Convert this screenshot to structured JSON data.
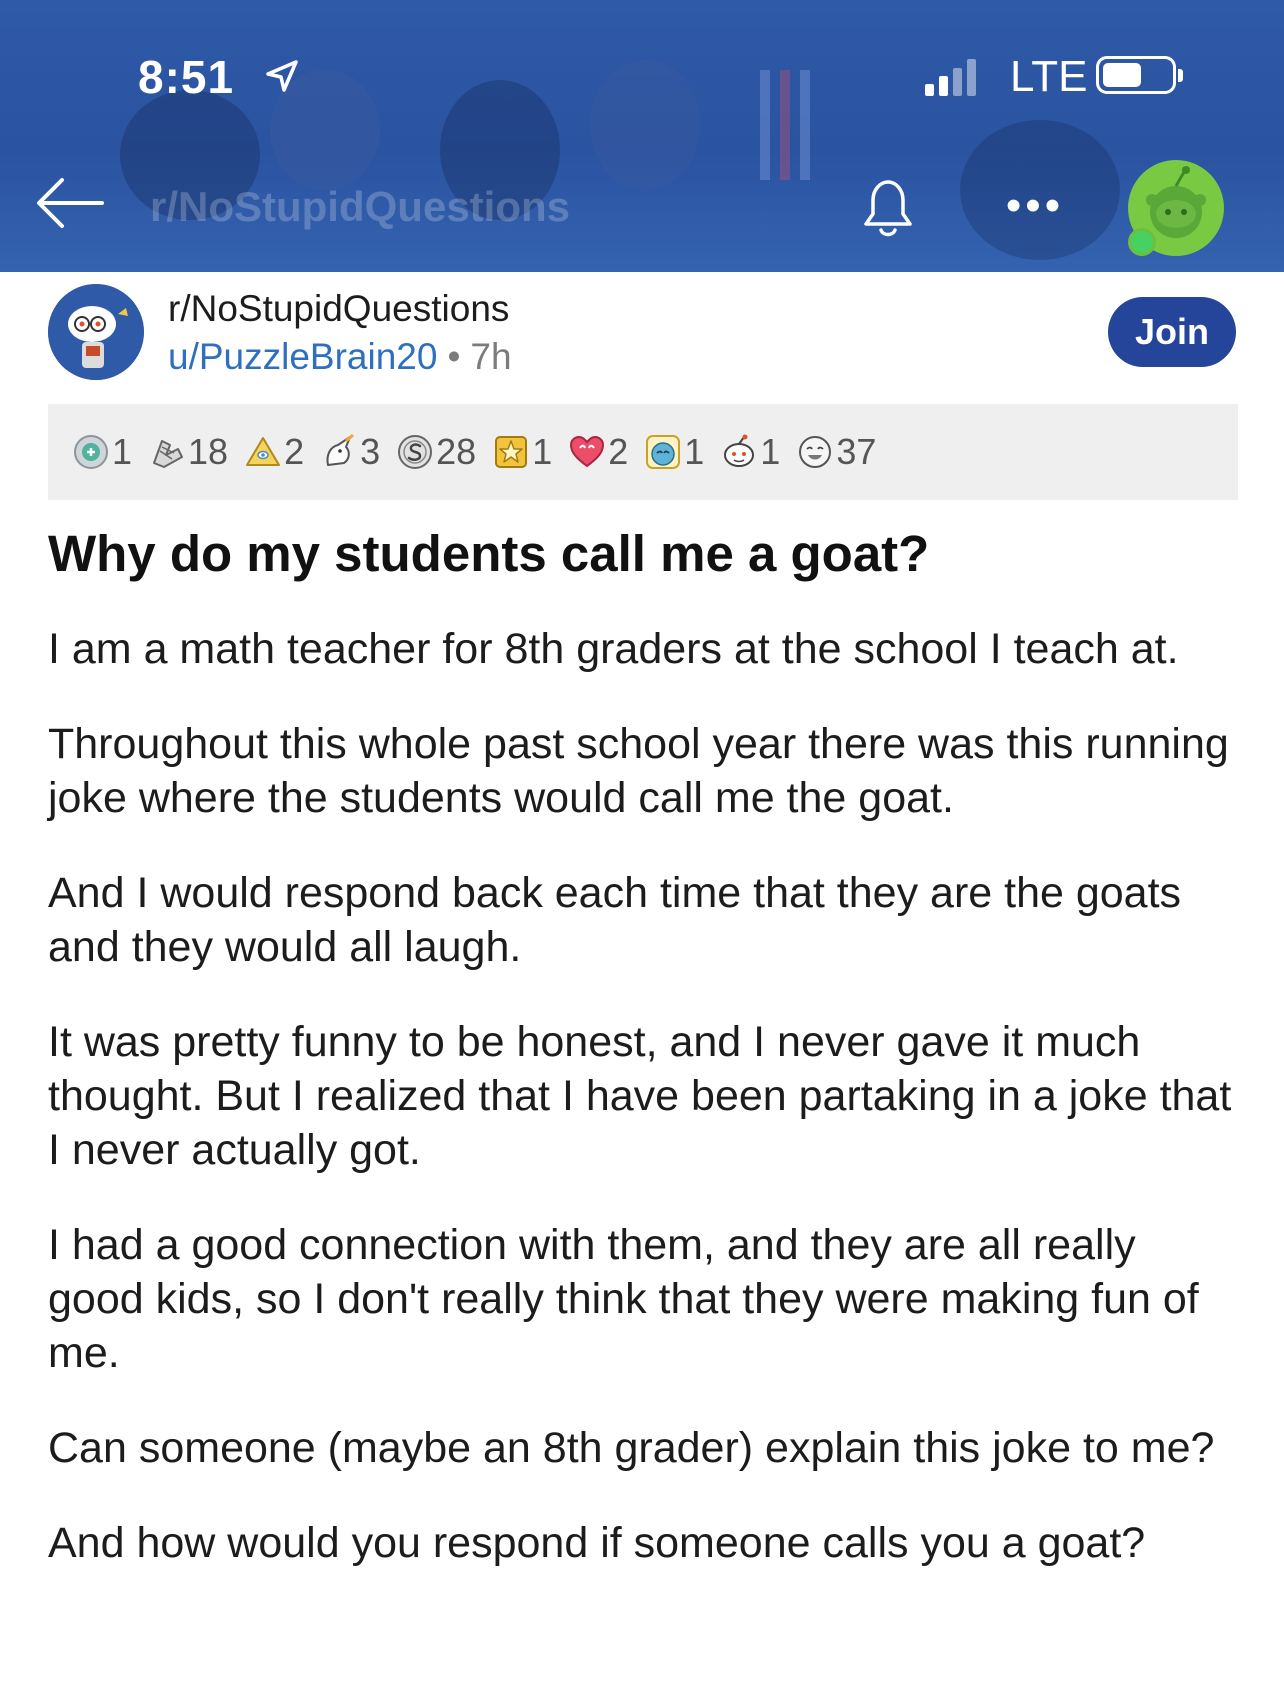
{
  "status_bar": {
    "time": "8:51",
    "network": "LTE"
  },
  "nav": {
    "subreddit_ghost": "r/NoStupidQuestions"
  },
  "post": {
    "subreddit": "r/NoStupidQuestions",
    "author": "u/PuzzleBrain20",
    "separator": "•",
    "age": "7h",
    "join_label": "Join",
    "awards": [
      {
        "icon": "hexagon-award-icon",
        "count": "1"
      },
      {
        "icon": "hands-award-icon",
        "count": "18"
      },
      {
        "icon": "pyramid-award-icon",
        "count": "2"
      },
      {
        "icon": "unicorn-award-icon",
        "count": "3"
      },
      {
        "icon": "coin-award-icon",
        "count": "28"
      },
      {
        "icon": "star-award-icon",
        "count": "1"
      },
      {
        "icon": "heart-award-icon",
        "count": "2"
      },
      {
        "icon": "crying-face-award-icon",
        "count": "1"
      },
      {
        "icon": "snoo-award-icon",
        "count": "1"
      },
      {
        "icon": "laughing-face-award-icon",
        "count": "37"
      }
    ],
    "title": "Why do my students call me a goat?",
    "paragraphs": [
      "I am a math teacher for 8th graders at the school I teach at.",
      "Throughout this whole past school year there was this running joke where the students would call me the goat.",
      "And I would respond back each time that they are the goats and they would all laugh.",
      "It was pretty funny to be honest, and I never gave it much thought. But I realized that I have been partaking in a joke that I never actually got.",
      "I had a good connection with them, and they are all really good kids, so I don't really think that they were making fun of me.",
      "Can someone (maybe an 8th grader) explain this joke to me?",
      "And how would you respond if someone calls you a goat?"
    ]
  },
  "colors": {
    "header_blue": "#2f5aa6",
    "join_button": "#24459a",
    "link_blue": "#2f6fbf",
    "award_bar": "#efefef"
  }
}
